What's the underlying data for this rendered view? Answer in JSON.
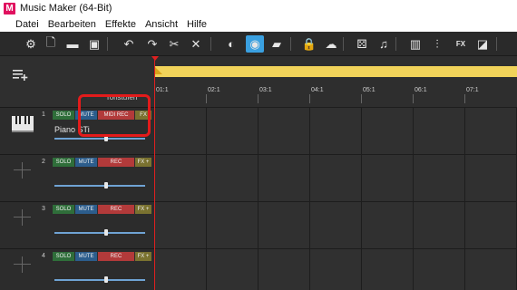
{
  "window": {
    "title": "Music Maker (64-Bit)",
    "logo": "M"
  },
  "menu": [
    "Datei",
    "Bearbeiten",
    "Effekte",
    "Ansicht",
    "Hilfe"
  ],
  "toolbar_icons": [
    {
      "name": "settings-gear-icon",
      "glyph": "⚙"
    },
    {
      "name": "new-file-icon",
      "glyph": "🗋"
    },
    {
      "name": "open-folder-icon",
      "glyph": "▬"
    },
    {
      "name": "save-disk-icon",
      "glyph": "▣"
    },
    {
      "name": "undo-icon",
      "glyph": "↶"
    },
    {
      "name": "redo-icon",
      "glyph": "↷"
    },
    {
      "name": "cut-scissors-icon",
      "glyph": "✂"
    },
    {
      "name": "delete-x-icon",
      "glyph": "✕"
    },
    {
      "name": "snap-icon",
      "glyph": "◐"
    },
    {
      "name": "loop-icon",
      "glyph": "◉"
    },
    {
      "name": "media-pool-icon",
      "glyph": "▰"
    },
    {
      "name": "shop-bag-icon",
      "glyph": "🔒"
    },
    {
      "name": "cloud-upload-icon",
      "glyph": "☁"
    },
    {
      "name": "dice-icon",
      "glyph": "⚄"
    },
    {
      "name": "music-note-icon",
      "glyph": "♫"
    },
    {
      "name": "keyboard-icon",
      "glyph": "▥"
    },
    {
      "name": "mixer-icon",
      "glyph": "⫶"
    },
    {
      "name": "fx-icon",
      "glyph": "FX"
    },
    {
      "name": "mastering-icon",
      "glyph": "◪"
    }
  ],
  "timeline": {
    "column_header": "Tonstufen",
    "markers": [
      "01:1",
      "02:1",
      "03:1",
      "04:1",
      "05:1",
      "06:1",
      "07:1"
    ]
  },
  "tracks": [
    {
      "number": "1",
      "name": "Piano",
      "sub": "STi",
      "solo": "SOLO",
      "mute": "MUTE",
      "rec": "MIDI REC",
      "fx": "FX",
      "volume": 0.57,
      "has_instrument": true
    },
    {
      "number": "2",
      "name": "",
      "sub": "",
      "solo": "SOLO",
      "mute": "MUTE",
      "rec": "REC",
      "fx": "FX +",
      "volume": 0.57,
      "has_instrument": false
    },
    {
      "number": "3",
      "name": "",
      "sub": "",
      "solo": "SOLO",
      "mute": "MUTE",
      "rec": "REC",
      "fx": "FX +",
      "volume": 0.57,
      "has_instrument": false
    },
    {
      "number": "4",
      "name": "",
      "sub": "",
      "solo": "SOLO",
      "mute": "MUTE",
      "rec": "REC",
      "fx": "FX +",
      "volume": 0.57,
      "has_instrument": false
    }
  ],
  "colors": {
    "playhead": "#e02020",
    "loop_bar": "#f1d35a",
    "highlight": "#e31b1b"
  }
}
